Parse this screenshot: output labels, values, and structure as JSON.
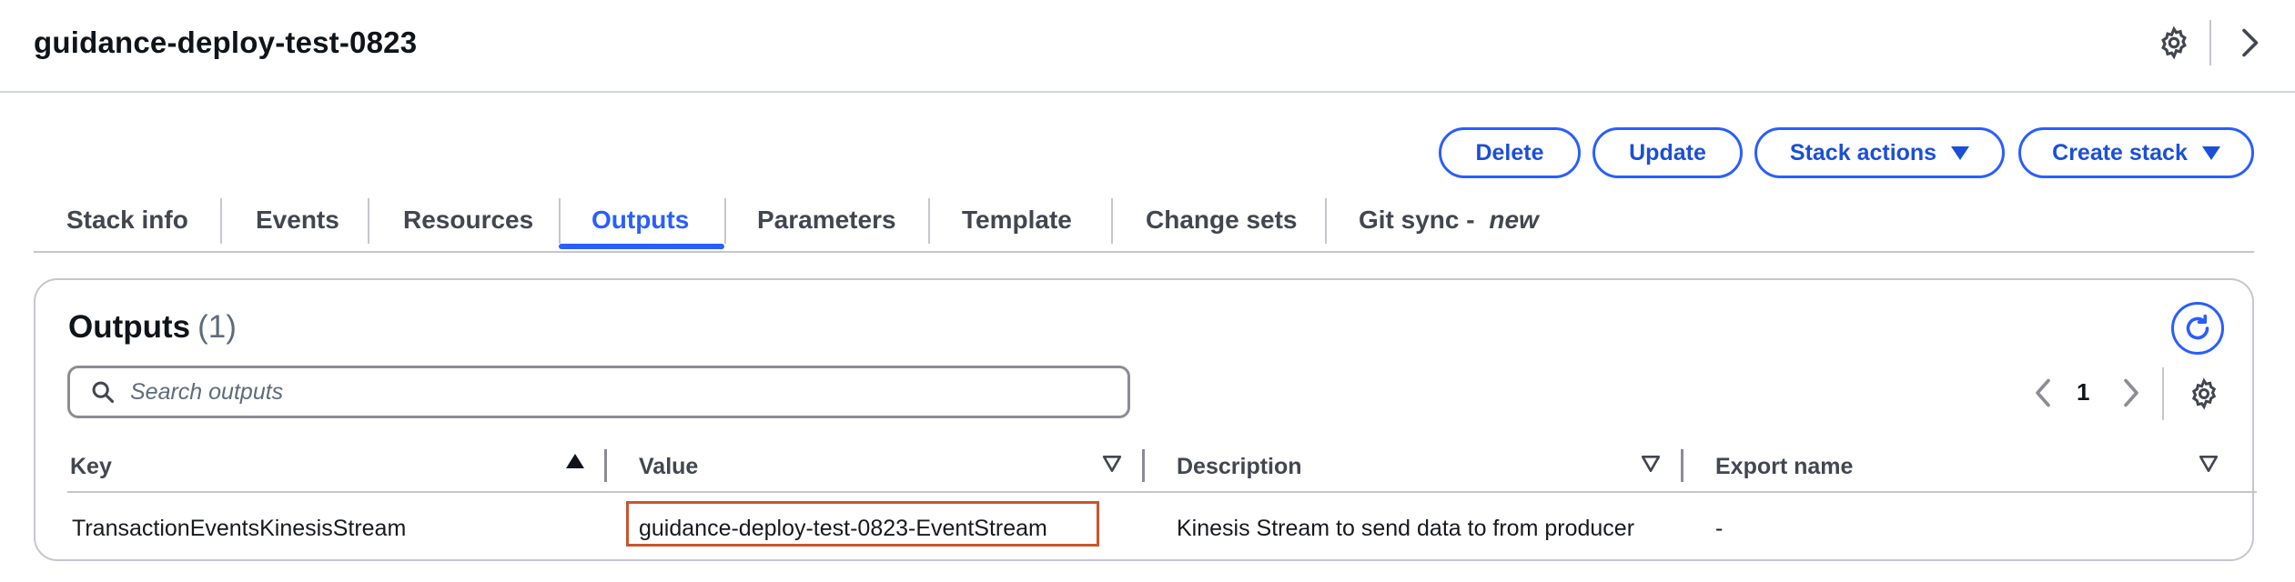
{
  "header": {
    "stack_name": "guidance-deploy-test-0823",
    "settings_icon": "gear-icon",
    "expand_icon": "chevron-right-icon"
  },
  "actions": {
    "delete_label": "Delete",
    "update_label": "Update",
    "stack_actions_label": "Stack actions",
    "create_stack_label": "Create stack"
  },
  "tabs": [
    {
      "label": "Stack info"
    },
    {
      "label": "Events"
    },
    {
      "label": "Resources"
    },
    {
      "label": "Outputs",
      "active": true
    },
    {
      "label": "Parameters"
    },
    {
      "label": "Template"
    },
    {
      "label": "Change sets"
    },
    {
      "label": "Git sync - ",
      "badge": "new"
    }
  ],
  "outputs": {
    "title": "Outputs",
    "count": "(1)",
    "search": {
      "placeholder": "Search outputs",
      "value": ""
    },
    "pagination": {
      "current_page": "1"
    },
    "columns": [
      {
        "label": "Key",
        "sort": "ascending"
      },
      {
        "label": "Value",
        "sort": "none"
      },
      {
        "label": "Description",
        "sort": "none"
      },
      {
        "label": "Export name",
        "sort": "none"
      }
    ],
    "rows": [
      {
        "key": "TransactionEventsKinesisStream",
        "value": "guidance-deploy-test-0823-EventStream",
        "description": "Kinesis Stream to send data to from producer",
        "export_name": "-"
      }
    ]
  },
  "colors": {
    "accent": "#295eff",
    "highlight_box": "#c9552e",
    "text": "#16191f",
    "border": "#c6c6cd"
  }
}
